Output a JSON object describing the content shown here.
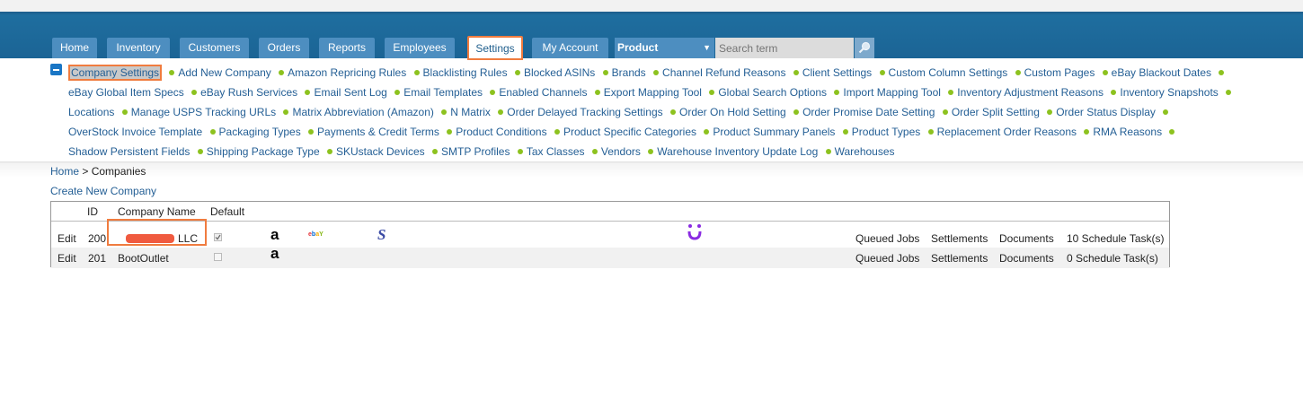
{
  "nav": {
    "tabs": [
      "Home",
      "Inventory",
      "Customers",
      "Orders",
      "Reports",
      "Employees",
      "Settings",
      "My Account"
    ],
    "active_tab": "Settings",
    "product_select": "Product",
    "search_placeholder": "Search term"
  },
  "settings_links": [
    "Company Settings",
    "Add New Company",
    "Amazon Repricing Rules",
    "Blacklisting Rules",
    "Blocked ASINs",
    "Brands",
    "Channel Refund Reasons",
    "Client Settings",
    "Custom Column Settings",
    "Custom Pages",
    "eBay Blackout Dates",
    "eBay Global Item Specs",
    "eBay Rush Services",
    "Email Sent Log",
    "Email Templates",
    "Enabled Channels",
    "Export Mapping Tool",
    "Global Search Options",
    "Import Mapping Tool",
    "Inventory Adjustment Reasons",
    "Inventory Snapshots",
    "Locations",
    "Manage USPS Tracking URLs",
    "Matrix Abbreviation (Amazon)",
    "N Matrix",
    "Order Delayed Tracking Settings",
    "Order On Hold Setting",
    "Order Promise Date Setting",
    "Order Split Setting",
    "Order Status Display",
    "OverStock Invoice Template",
    "Packaging Types",
    "Payments & Credit Terms",
    "Product Conditions",
    "Product Specific Categories",
    "Product Summary Panels",
    "Product Types",
    "Replacement Order Reasons",
    "RMA Reasons",
    "Shadow Persistent Fields",
    "Shipping Package Type",
    "SKUstack Devices",
    "SMTP Profiles",
    "Tax Classes",
    "Vendors",
    "Warehouse Inventory Update Log",
    "Warehouses"
  ],
  "breadcrumb": {
    "home": "Home",
    "separator": ">",
    "current": "Companies"
  },
  "create_link": "Create New Company",
  "table": {
    "headers": {
      "id": "ID",
      "name": "Company Name",
      "default": "Default"
    },
    "rows": [
      {
        "edit": "Edit",
        "id": "200",
        "name_suffix": "LLC",
        "default_checked": true,
        "channels": [
          "amazon-icon",
          "ebay-icon",
          "sears-icon",
          "jet-icon"
        ],
        "queued": "Queued Jobs",
        "settlements": "Settlements",
        "documents": "Documents",
        "tasks": "10 Schedule Task(s)"
      },
      {
        "edit": "Edit",
        "id": "201",
        "name": "BootOutlet",
        "default_checked": false,
        "channels": [
          "amazon-icon"
        ],
        "queued": "Queued Jobs",
        "settlements": "Settlements",
        "documents": "Documents",
        "tasks": "0 Schedule Task(s)"
      }
    ]
  },
  "colors": {
    "header": "#1f6e9f",
    "tab": "#4d8ec0",
    "highlight": "#f07c3f",
    "link": "#245f95",
    "bullet": "#8dc21f"
  }
}
